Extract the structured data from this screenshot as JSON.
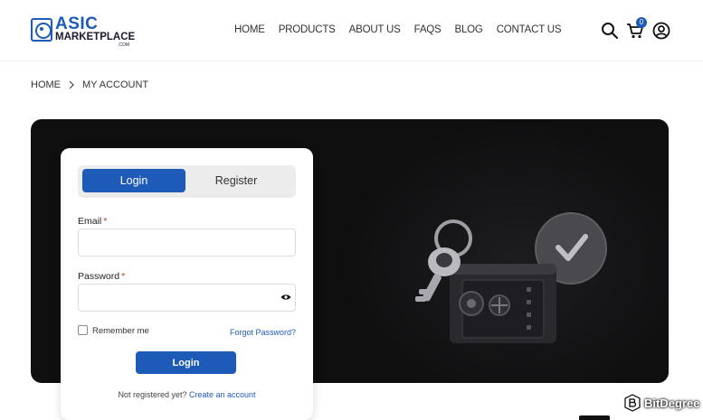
{
  "brand": {
    "line1": "ASIC",
    "line2": "MARKETPLACE",
    "line3": ".COM",
    "color": "#1e5bb8"
  },
  "nav": [
    "HOME",
    "PRODUCTS",
    "ABOUT US",
    "FAQS",
    "BLOG",
    "CONTACT US"
  ],
  "header_icons": {
    "search": "search-icon",
    "cart": "cart-icon",
    "account": "user-icon",
    "cart_count": "0"
  },
  "breadcrumb": {
    "home": "HOME",
    "current": "MY ACCOUNT"
  },
  "auth": {
    "tabs": {
      "login": "Login",
      "register": "Register"
    },
    "email_label": "Email",
    "email_value": "",
    "password_label": "Password",
    "password_value": "",
    "required_mark": "*",
    "remember_label": "Remember me",
    "remember_checked": false,
    "forgot_label": "Forgot Password?",
    "submit_label": "Login",
    "not_registered": "Not registered yet?",
    "create_account": "Create an account"
  },
  "watermark": {
    "text": "BitDegree"
  },
  "colors": {
    "accent": "#1e5bb8",
    "banner": "#0f0f10",
    "required": "#d0312d"
  }
}
